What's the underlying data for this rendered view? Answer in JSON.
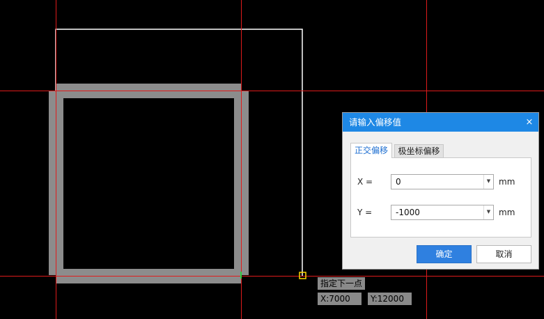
{
  "dialog": {
    "title": "请输入偏移值",
    "close_glyph": "×",
    "tabs": [
      {
        "label": "正交偏移",
        "active": true
      },
      {
        "label": "极坐标偏移",
        "active": false
      }
    ],
    "fields": [
      {
        "label": "X =",
        "value": "0",
        "unit": "mm"
      },
      {
        "label": "Y =",
        "value": "-1000",
        "unit": "mm"
      }
    ],
    "ok_label": "确定",
    "cancel_label": "取消"
  },
  "prompt": {
    "text": "指定下一点",
    "x_readout": "X:7000",
    "y_readout": "Y:12000"
  },
  "colors": {
    "background": "#000000",
    "crosshair": "#e01b1b",
    "rubber_band": "#ffffff",
    "wall": "#8c8c8c",
    "snap_marker": "#ffd800",
    "accent": "#1e88e5"
  },
  "icons": {
    "close": "close-icon",
    "dropdown": "chevron-down-icon",
    "snap": "endpoint-snap-icon"
  }
}
